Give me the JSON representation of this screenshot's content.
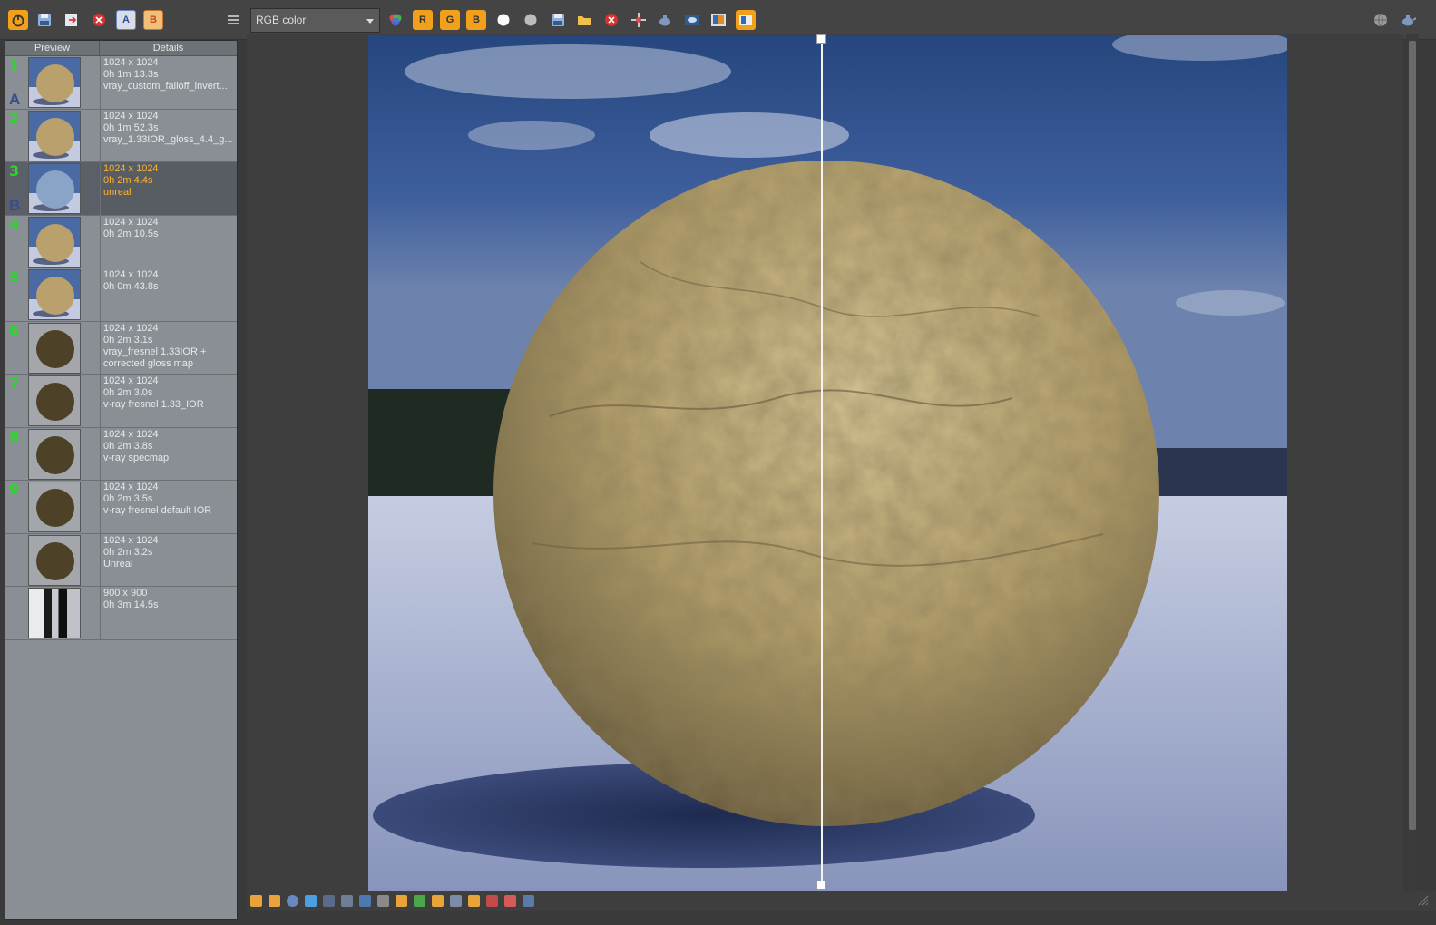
{
  "toolbar": {
    "channel": "RGB color",
    "left_buttons": [
      "power-icon",
      "save-icon",
      "export-icon",
      "clear-icon",
      "a-icon",
      "b-icon"
    ],
    "a_label": "A",
    "b_label": "B",
    "channel_buttons": {
      "r": "R",
      "g": "G",
      "b": "B"
    },
    "accent": "#f2a01c"
  },
  "history": {
    "header": {
      "preview": "Preview",
      "details": "Details"
    },
    "items": [
      {
        "num": "1",
        "ab": "A",
        "lines": [
          "1024 x 1024",
          "0h 1m 13.3s",
          "vray_custom_falloff_invert..."
        ],
        "thumb": "sky"
      },
      {
        "num": "2",
        "ab": "",
        "lines": [
          "1024 x 1024",
          "0h 1m 52.3s",
          "vray_1.33IOR_gloss_4.4_g..."
        ],
        "thumb": "sky"
      },
      {
        "num": "3",
        "ab": "B",
        "lines": [
          "1024 x 1024",
          "0h 2m 4.4s",
          "unreal"
        ],
        "thumb": "blue",
        "selected": true
      },
      {
        "num": "4",
        "ab": "",
        "lines": [
          "1024 x 1024",
          "0h 2m 10.5s"
        ],
        "thumb": "sky"
      },
      {
        "num": "5",
        "ab": "",
        "lines": [
          "1024 x 1024",
          "0h 0m 43.8s"
        ],
        "thumb": "sky"
      },
      {
        "num": "6",
        "ab": "",
        "lines": [
          "1024 x 1024",
          "0h 2m 3.1s",
          "vray_fresnel 1.33IOR +",
          "corrected gloss map"
        ],
        "thumb": "dark"
      },
      {
        "num": "7",
        "ab": "",
        "lines": [
          "1024 x 1024",
          "0h 2m 3.0s",
          "v-ray fresnel 1.33_IOR"
        ],
        "thumb": "dark"
      },
      {
        "num": "8",
        "ab": "",
        "lines": [
          "1024 x 1024",
          "0h 2m 3.8s",
          "v-ray specmap"
        ],
        "thumb": "dark"
      },
      {
        "num": "9",
        "ab": "",
        "lines": [
          "1024 x 1024",
          "0h 2m 3.5s",
          "v-ray fresnel default IOR"
        ],
        "thumb": "dark"
      },
      {
        "num": "",
        "ab": "",
        "lines": [
          "1024 x 1024",
          "0h 2m 3.2s",
          "Unreal"
        ],
        "thumb": "dark"
      },
      {
        "num": "",
        "ab": "",
        "lines": [
          "900 x 900",
          "0h 3m 14.5s"
        ],
        "thumb": "room"
      }
    ]
  }
}
